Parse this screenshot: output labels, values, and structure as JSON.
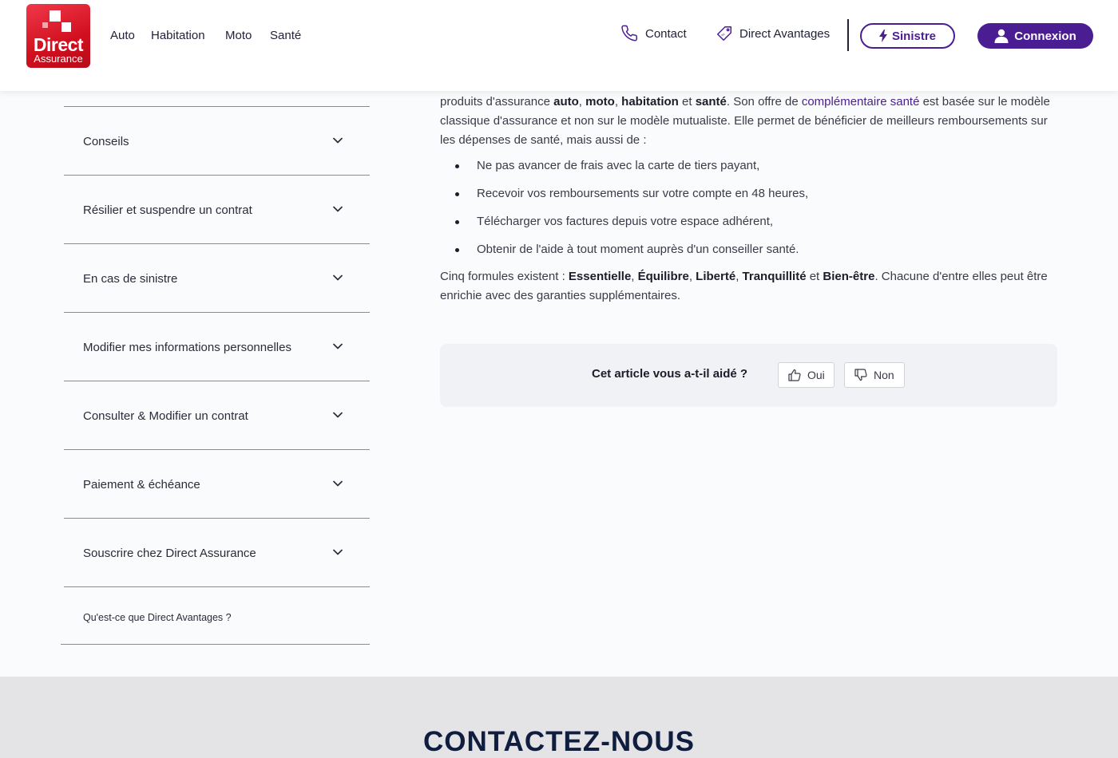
{
  "header": {
    "logo": {
      "line1": "Direct",
      "line2": "Assurance",
      "color": "#d0101f"
    },
    "nav": [
      "Auto",
      "Habitation",
      "Moto",
      "Santé"
    ],
    "contact_label": "Contact",
    "contact_icon": "phone-icon",
    "avantages_label": "Direct Avantages",
    "avantages_icon": "ticket-icon",
    "sinistre_label": "Sinistre",
    "sinistre_icon": "lightning-icon",
    "connexion_label": "Connexion",
    "connexion_icon": "user-icon",
    "accent_color": "#4b1d93"
  },
  "sidebar": {
    "items": [
      {
        "label": "Conseils"
      },
      {
        "label": "Résilier et suspendre un contrat"
      },
      {
        "label": "En cas de sinistre"
      },
      {
        "label": "Modifier mes informations personnelles"
      },
      {
        "label": "Consulter & Modifier un contrat"
      },
      {
        "label": "Paiement & échéance"
      },
      {
        "label": "Souscrire chez Direct Assurance"
      }
    ],
    "last_link": "Qu'est-ce que Direct Avantages ?"
  },
  "article": {
    "p1": {
      "t1": "produits d'assurance ",
      "b1": "auto",
      "t2": ", ",
      "b2": "moto",
      "t3": ", ",
      "b3": "habitation",
      "t4": " et ",
      "b4": "santé",
      "t5": ". Son offre de ",
      "link": "complémentaire santé",
      "t6": " est basée sur le modèle classique d'assurance et non sur le modèle mutualiste. Elle permet de bénéficier de meilleurs remboursements sur les dépenses de santé, mais aussi de :"
    },
    "bullets": [
      "Ne pas avancer de frais avec la carte de tiers payant,",
      "Recevoir vos remboursements sur votre compte en 48 heures,",
      "Télécharger vos factures depuis votre espace adhérent,",
      "Obtenir de l'aide à tout moment auprès d'un conseiller santé."
    ],
    "p2": {
      "t1": "Cinq formules existent : ",
      "b1": "Essentielle",
      "t2": ", ",
      "b2": "Équilibre",
      "t3": ", ",
      "b3": "Liberté",
      "t4": ", ",
      "b4": "Tranquillité",
      "t5": " et ",
      "b5": "Bien-être",
      "t6": ". Chacune d'entre elles peut être enrichie avec des garanties supplémentaires."
    }
  },
  "feedback": {
    "question": "Cet article vous a-t-il aidé ?",
    "yes_label": "Oui",
    "no_label": "Non",
    "yes_icon": "thumbs-up-icon",
    "no_icon": "thumbs-down-icon"
  },
  "contact_section": {
    "title": "CONTACTEZ-NOUS"
  }
}
